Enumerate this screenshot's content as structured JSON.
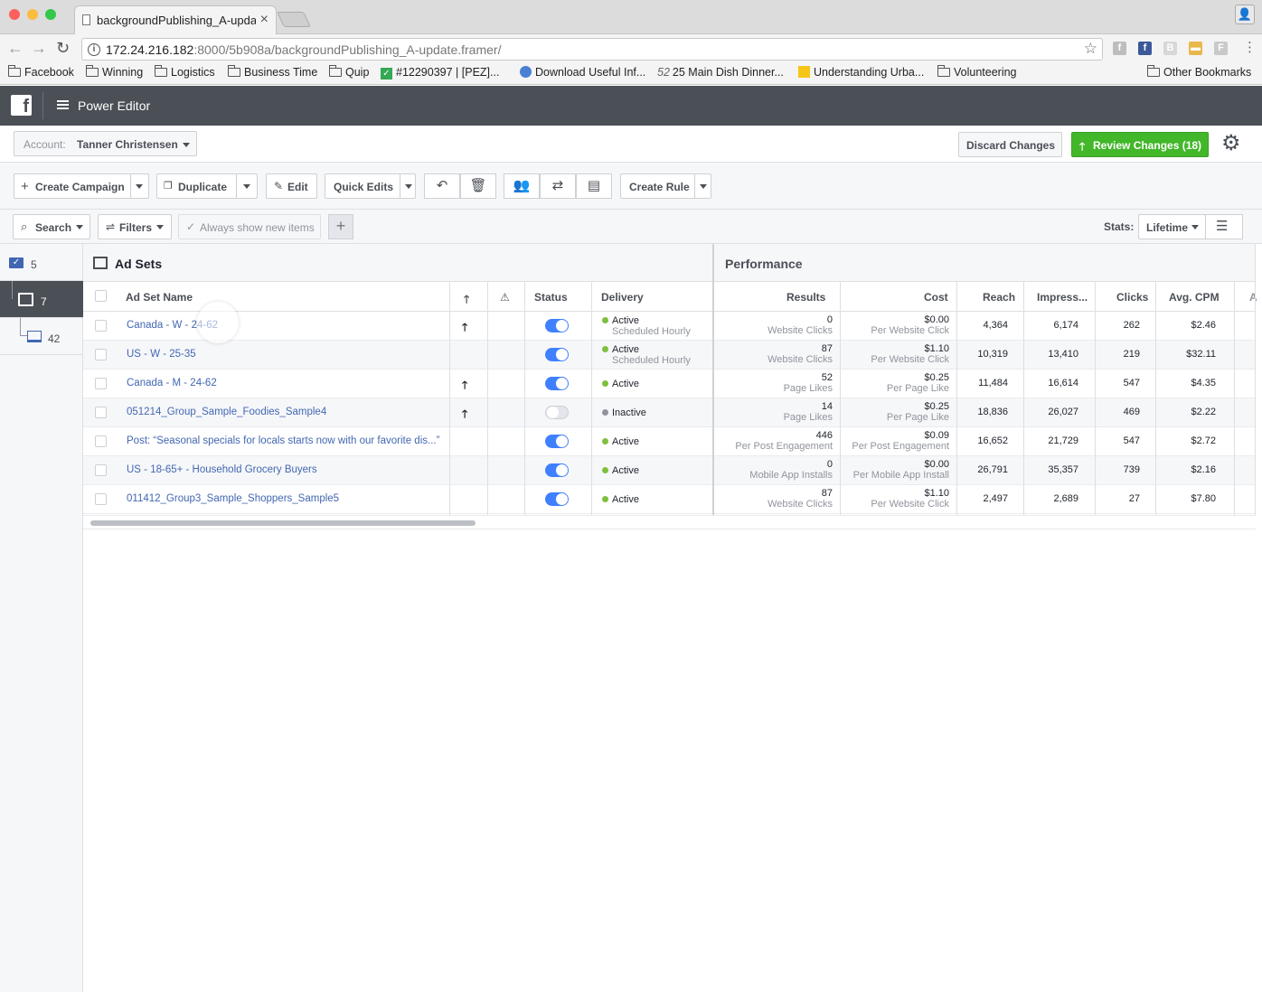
{
  "browser": {
    "tab_title": "backgroundPublishing_A-update.framer/",
    "tab_close": "×",
    "url_host": "172.24.216.182",
    "url_rest": ":8000/5b908a/backgroundPublishing_A-update.framer/",
    "bookmarks": [
      {
        "label": "Facebook"
      },
      {
        "label": "Winning"
      },
      {
        "label": "Logistics"
      },
      {
        "label": "Business Time"
      },
      {
        "label": "Quip"
      },
      {
        "label": "#12290397 | [PEZ]..."
      },
      {
        "label": "Download Useful Inf..."
      },
      {
        "label": "25 Main Dish Dinner..."
      },
      {
        "label": "Understanding Urba..."
      },
      {
        "label": "Volunteering"
      }
    ],
    "other_bookmarks": "Other Bookmarks",
    "bookmark_badge": "52"
  },
  "header": {
    "title": "Power Editor",
    "logo": "f"
  },
  "account": {
    "label": "Account:",
    "name": "Tanner Christensen",
    "discard": "Discard Changes",
    "review": "Review Changes (18)"
  },
  "toolbar": {
    "create_campaign": "Create Campaign",
    "duplicate": "Duplicate",
    "edit": "Edit",
    "quick_edits": "Quick Edits",
    "create_rule": "Create Rule"
  },
  "filters": {
    "search": "Search",
    "filters": "Filters",
    "always_show": "Always show new items",
    "stats_label": "Stats:",
    "stats_value": "Lifetime"
  },
  "leftnav": {
    "campaigns_count": "5",
    "adsets_count": "7",
    "ads_count": "42"
  },
  "grid": {
    "section_title": "Ad Sets",
    "performance_title": "Performance",
    "columns": {
      "name": "Ad Set Name",
      "status": "Status",
      "delivery": "Delivery",
      "results": "Results",
      "cost": "Cost",
      "reach": "Reach",
      "impressions": "Impress...",
      "clicks": "Clicks",
      "cpm": "Avg. CPM",
      "more": "A"
    },
    "rows": [
      {
        "name": "Canada - W - 24-62",
        "arrow": "🡑",
        "status_on": true,
        "delivery": "Active",
        "delivery_sub": "Scheduled Hourly",
        "results": "0",
        "results_sub": "Website Clicks",
        "cost": "$0.00",
        "cost_sub": "Per Website Click",
        "reach": "4,364",
        "impressions": "6,174",
        "clicks": "262",
        "cpm": "$2.46"
      },
      {
        "name": "US - W - 25-35",
        "arrow": "",
        "status_on": true,
        "delivery": "Active",
        "delivery_sub": "Scheduled Hourly",
        "results": "87",
        "results_sub": "Website Clicks",
        "cost": "$1.10",
        "cost_sub": "Per Website Click",
        "reach": "10,319",
        "impressions": "13,410",
        "clicks": "219",
        "cpm": "$32.11"
      },
      {
        "name": "Canada - M - 24-62",
        "arrow": "🡑",
        "status_on": true,
        "delivery": "Active",
        "delivery_sub": "",
        "results": "52",
        "results_sub": "Page Likes",
        "cost": "$0.25",
        "cost_sub": "Per Page Like",
        "reach": "11,484",
        "impressions": "16,614",
        "clicks": "547",
        "cpm": "$4.35"
      },
      {
        "name": "051214_Group_Sample_Foodies_Sample4",
        "arrow": "🡑",
        "status_on": false,
        "delivery": "Inactive",
        "delivery_sub": "",
        "results": "14",
        "results_sub": "Page Likes",
        "cost": "$0.25",
        "cost_sub": "Per Page Like",
        "reach": "18,836",
        "impressions": "26,027",
        "clicks": "469",
        "cpm": "$2.22"
      },
      {
        "name": "Post: “Seasonal specials for locals starts now with our favorite dis...”",
        "arrow": "",
        "status_on": true,
        "delivery": "Active",
        "delivery_sub": "",
        "results": "446",
        "results_sub": "Per Post Engagement",
        "cost": "$0.09",
        "cost_sub": "Per Post Engagement",
        "reach": "16,652",
        "impressions": "21,729",
        "clicks": "547",
        "cpm": "$2.72"
      },
      {
        "name": "US - 18-65+ - Household Grocery Buyers",
        "arrow": "",
        "status_on": true,
        "delivery": "Active",
        "delivery_sub": "",
        "results": "0",
        "results_sub": "Mobile App Installs",
        "cost": "$0.00",
        "cost_sub": "Per Mobile App Install",
        "reach": "26,791",
        "impressions": "35,357",
        "clicks": "739",
        "cpm": "$2.16"
      },
      {
        "name": "011412_Group3_Sample_Shoppers_Sample5",
        "arrow": "",
        "status_on": true,
        "delivery": "Active",
        "delivery_sub": "",
        "results": "87",
        "results_sub": "Website Clicks",
        "cost": "$1.10",
        "cost_sub": "Per Website Click",
        "reach": "2,497",
        "impressions": "2,689",
        "clicks": "27",
        "cpm": "$7.80"
      }
    ]
  },
  "colors": {
    "header_bg": "#4b4f56",
    "link": "#4267b2",
    "review_green": "#42b72a",
    "toggle_blue": "#4080ff",
    "active_dot": "#7fbf3f"
  }
}
